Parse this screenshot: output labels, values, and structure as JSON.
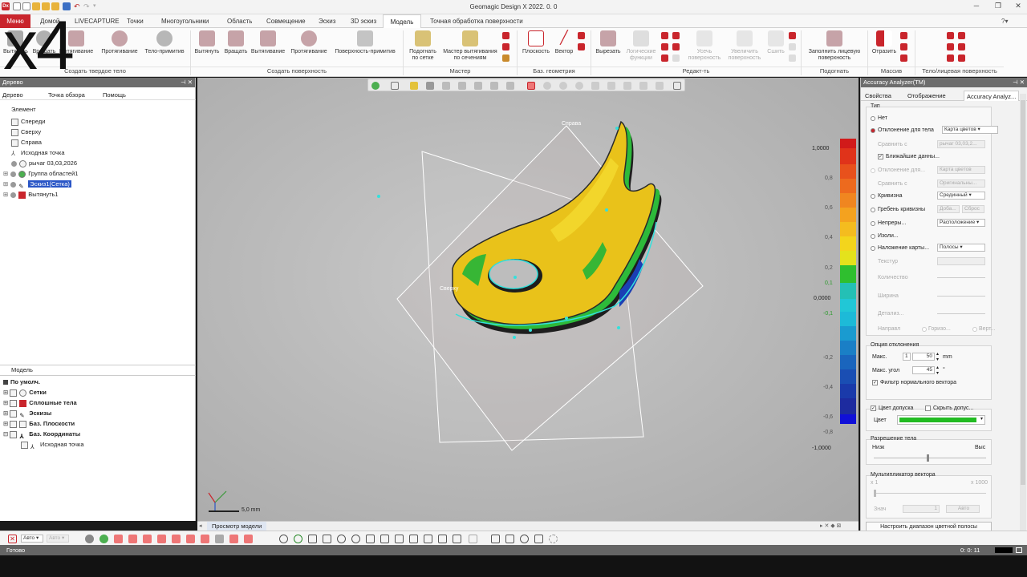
{
  "window": {
    "title": "Geomagic Design X 2022. 0. 0",
    "app_icon": "Dx",
    "zoom_badge": "x4"
  },
  "tabs": [
    "Меню",
    "Домой",
    "LIVECAPTURE",
    "Точки",
    "Многоугольники",
    "Область",
    "Совмещение",
    "Эскиз",
    "3D эскиз",
    "Модель",
    "Точная обработка поверхности"
  ],
  "ribbon": {
    "buttons": [
      {
        "label": "Вытянуть",
        "group": "solid"
      },
      {
        "label": "Вращать",
        "group": "solid"
      },
      {
        "label": "Вытягивание",
        "group": "solid"
      },
      {
        "label": "Протягивание",
        "group": "solid"
      },
      {
        "label": "Тело-примитив",
        "group": "solid"
      },
      {
        "label": "Вытянуть",
        "group": "surf"
      },
      {
        "label": "Вращать",
        "group": "surf"
      },
      {
        "label": "Вытягивание",
        "group": "surf"
      },
      {
        "label": "Протягивание",
        "group": "surf"
      },
      {
        "label": "Поверхность-примитив",
        "group": "surf"
      },
      {
        "label": "Подогнать по сетке",
        "group": "master"
      },
      {
        "label": "Мастер вытягивания по сечениям",
        "group": "master"
      },
      {
        "label": "Плоскость",
        "group": "geom"
      },
      {
        "label": "Вектор",
        "group": "geom"
      },
      {
        "label": "Вырезать",
        "group": "edit"
      },
      {
        "label": "Логические функции",
        "group": "edit"
      },
      {
        "label": "Усечь поверхность",
        "group": "edit"
      },
      {
        "label": "Увеличить поверхность",
        "group": "edit"
      },
      {
        "label": "Сшить",
        "group": "edit"
      },
      {
        "label": "Заполнить лицевую поверхность",
        "group": "fit"
      },
      {
        "label": "Отразить",
        "group": "mass"
      }
    ],
    "groups": [
      "Создать твердое тело",
      "Создать поверхность",
      "Мастер",
      "Баз. геометрия",
      "Редакт-ть",
      "Подогнать",
      "Массив",
      "Тело/лицевая поверхность"
    ]
  },
  "tree_panel": {
    "title": "Дерево",
    "subtabs": [
      "Дерево",
      "Точка обзора",
      "Помощь"
    ],
    "section": "Элемент",
    "items": [
      "Спереди",
      "Сверху",
      "Справа",
      "Исходная точка",
      "рычаг 03,03,2026",
      "Группа областей1",
      "Эскиз1(Сетка)",
      "Вытянуть1"
    ]
  },
  "model_panel": {
    "section": "Модель",
    "items": [
      "По умолч.",
      "Сетки",
      "Сплошные тела",
      "Эскизы",
      "Баз. Плоскости",
      "Баз. Координаты",
      "Исходная точка"
    ]
  },
  "viewport": {
    "labels": [
      "Справа",
      "Сверху"
    ],
    "scale_bar": "5,0 mm",
    "view_tab": "Просмотр модели",
    "color_scale": [
      "1,0000",
      "0,8",
      "0,6",
      "0,4",
      "0,2",
      "0,1",
      "0,0000",
      "-0,1",
      "-0,2",
      "-0,4",
      "-0,6",
      "-0,8",
      "-1,0000"
    ]
  },
  "analyzer": {
    "title": "Accuracy Analyzer(TM)",
    "tabs": [
      "Свойства",
      "Отображение",
      "Accuracy Analyz..."
    ],
    "type_label": "Тип",
    "none": "Нет",
    "deviation": "Отклонение для тела",
    "deviation_value": "Карта цветов",
    "compare": "Сравнить с",
    "compare_value": "рычаг 03,03,2...",
    "nearest": "Ближайшие данны...",
    "deviation2": "Отклонение для...",
    "deviation2_value": "Карта цветов",
    "compare2": "Сравнить с",
    "compare2_value": "Оригинальны...",
    "curvature": "Кривизна",
    "curvature_value": "Срединный",
    "comb": "Гребень кривизны",
    "comb_v1": "Доба...",
    "comb_v2": "Сброс",
    "continuity": "Непреры...",
    "continuity_value": "Расположение",
    "isoline": "Изоли...",
    "overlay": "Наложение карты...",
    "overlay_value": "Полосы",
    "texture": "Текстур",
    "count": "Количество",
    "width": "Ширина",
    "detail": "Детализ...",
    "direction": "Направл",
    "dir_h": "Горизо...",
    "dir_v": "Верт...",
    "dev_opt": "Опция отклонения",
    "max": "Макс.",
    "max_value": "50",
    "mm": "mm",
    "max_angle": "Макс. угол",
    "angle_value": "45",
    "deg": "°",
    "filter": "Фильтр нормального вектора",
    "tol_color": "Цвет допуска",
    "hide_tol": "Скрыть допус...",
    "color": "Цвет",
    "resolution": "Разрешение тела",
    "low": "Низк",
    "high": "Выс",
    "vec_mult": "Мультипликатор вектора",
    "x1": "x 1",
    "x1000": "x 1000",
    "value": "Знач",
    "value_num": "1",
    "auto": "Авто",
    "range_btn": "Настроить диапазон цветной полосы"
  },
  "bottom": {
    "auto1": "Авто",
    "auto2": "Авто"
  },
  "status": {
    "left": "Готово",
    "right": "0: 0: 11"
  }
}
